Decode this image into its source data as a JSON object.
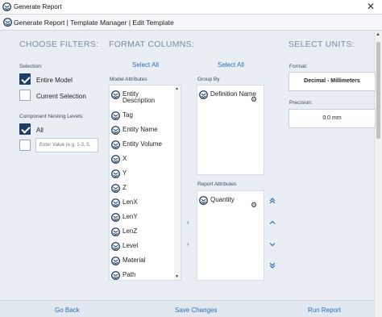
{
  "window": {
    "title": "Generate Report",
    "close_glyph": "✕",
    "app_icon": "sketchup-logo-icon"
  },
  "header": {
    "breadcrumb": "Generate Report | Template Manager | Edit Template"
  },
  "filters": {
    "heading": "CHOOSE FILTERS:",
    "selection_label": "Selection:",
    "entire_model": {
      "label": "Entire Model",
      "checked": true
    },
    "current_selection": {
      "label": "Current Selection",
      "checked": false
    },
    "nesting_label": "Component Nesting Levels:",
    "all": {
      "label": "All",
      "checked": true
    },
    "custom": {
      "checked": false,
      "placeholder": "Enter Value (e.g. 1-3, 5,"
    }
  },
  "columns": {
    "heading": "FORMAT COLUMNS:",
    "select_all_left": "Select All",
    "select_all_right": "Select All",
    "model_attributes_label": "Model Attributes",
    "model_attributes": [
      "Entity Description",
      "Tag",
      "Entity Name",
      "Entity Volume",
      "X",
      "Y",
      "Z",
      "LenX",
      "LenY",
      "LenZ",
      "Level",
      "Material",
      "Path"
    ],
    "group_by_label": "Group By",
    "group_by": [
      "Definition Name"
    ],
    "report_attributes_label": "Report Attributes",
    "report_attributes": [
      "Quantity"
    ],
    "move_left_glyph": "‹",
    "move_right_glyph": "›",
    "order_buttons": [
      "«top",
      "‹up",
      "›down",
      "»bottom"
    ]
  },
  "units": {
    "heading": "SELECT UNITS:",
    "format_label": "Format:",
    "format_value": "Decimal - Millimeters",
    "precision_label": "Precision:",
    "precision_value": "0.0 mm"
  },
  "footer": {
    "go_back": "Go Back",
    "save_changes": "Save Changes",
    "run_report": "Run Report"
  },
  "colors": {
    "accent": "#2a6fb8",
    "checkbox": "#1f3e66",
    "heading": "#7c8ba0",
    "background": "#e9eef4"
  }
}
